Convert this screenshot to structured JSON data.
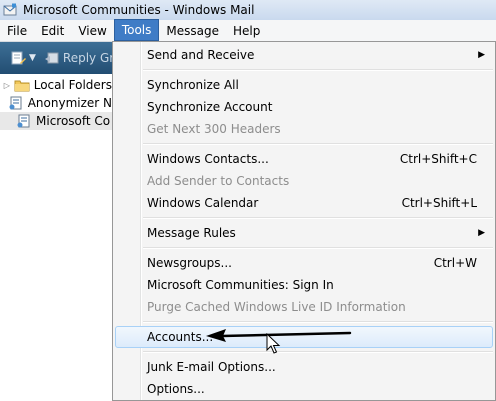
{
  "window": {
    "title": "Microsoft Communities - Windows Mail"
  },
  "menubar": {
    "items": [
      {
        "label": "File"
      },
      {
        "label": "Edit"
      },
      {
        "label": "View"
      },
      {
        "label": "Tools",
        "active": true
      },
      {
        "label": "Message"
      },
      {
        "label": "Help"
      }
    ]
  },
  "toolbar": {
    "reply_label": "Reply Gr"
  },
  "folders": [
    {
      "label": "Local Folders",
      "icon": "folder-icon"
    },
    {
      "label": "Anonymizer N",
      "icon": "newsgroup-icon"
    },
    {
      "label": "Microsoft Co",
      "icon": "newsgroup-icon",
      "selected": true
    }
  ],
  "tools_menu": {
    "send_receive": "Send and Receive",
    "synchronize_all": "Synchronize All",
    "synchronize_account": "Synchronize Account",
    "get_next_headers": "Get Next 300 Headers",
    "windows_contacts": "Windows Contacts...",
    "windows_contacts_shortcut": "Ctrl+Shift+C",
    "add_sender": "Add Sender to Contacts",
    "windows_calendar": "Windows Calendar",
    "windows_calendar_shortcut": "Ctrl+Shift+L",
    "message_rules": "Message Rules",
    "newsgroups": "Newsgroups...",
    "newsgroups_shortcut": "Ctrl+W",
    "communities_sign_in": "Microsoft Communities: Sign In",
    "purge_cached": "Purge Cached Windows Live ID Information",
    "accounts": "Accounts...",
    "junk_options": "Junk E-mail Options...",
    "options": "Options..."
  },
  "colors": {
    "menu_active": "#3f7cc6",
    "toolbar": "#2f5d82",
    "highlight_border": "#a8d1f7",
    "disabled_text": "#8d8d8d"
  }
}
